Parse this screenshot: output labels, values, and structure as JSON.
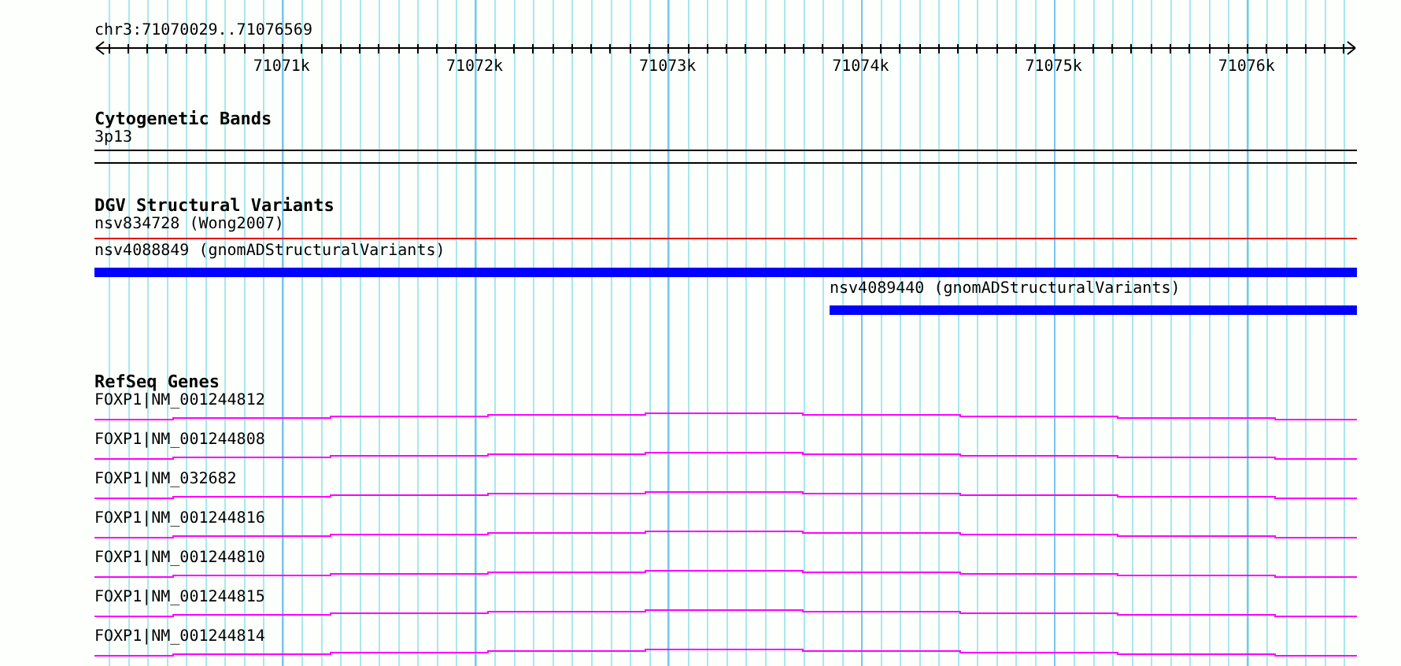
{
  "location": "chr3:71070029..71076569",
  "ruler": {
    "ticks": [
      "71071k",
      "71072k",
      "71073k",
      "71074k",
      "71075k",
      "71076k"
    ]
  },
  "tracks": [
    {
      "kind": "bands",
      "title": "Cytogenetic Bands",
      "features": [
        {
          "label": "3p13"
        }
      ]
    },
    {
      "kind": "variants",
      "title": "DGV Structural Variants",
      "features": [
        {
          "kind": "line",
          "label": "nsv834728 (Wong2007)"
        },
        {
          "kind": "bar",
          "label": "nsv4088849 (gnomADStructuralVariants)"
        },
        {
          "kind": "bar",
          "label": "nsv4089440 (gnomADStructuralVariants)"
        }
      ]
    },
    {
      "kind": "genes",
      "title": "RefSeq Genes",
      "features": [
        {
          "label": "FOXP1|NM_001244812"
        },
        {
          "label": "FOXP1|NM_001244808"
        },
        {
          "label": "FOXP1|NM_032682"
        },
        {
          "label": "FOXP1|NM_001244816"
        },
        {
          "label": "FOXP1|NM_001244810"
        },
        {
          "label": "FOXP1|NM_001244815"
        },
        {
          "label": "FOXP1|NM_001244814"
        }
      ]
    }
  ]
}
